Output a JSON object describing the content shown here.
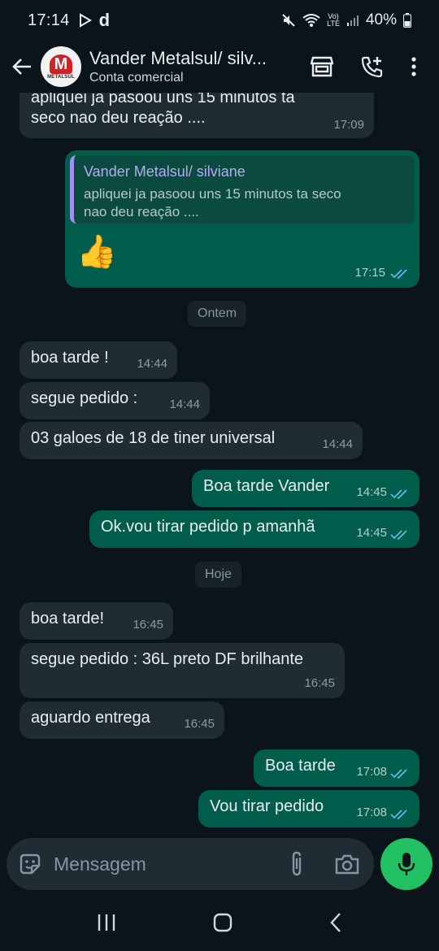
{
  "status": {
    "time": "17:14",
    "battery": "40%",
    "volte_top": "Vo)",
    "volte_bottom": "LTE"
  },
  "header": {
    "name": "Vander Metalsul/ silv...",
    "subtitle": "Conta comercial",
    "avatar_text": "METALSUL"
  },
  "messages": [
    {
      "text1": "apliquei ja pasoou uns 15 minutos ta",
      "text2": "seco nao deu reação ....",
      "time": "17:09"
    },
    {
      "quote_name": "Vander Metalsul/ silviane",
      "quote_text1": "apliquei ja pasoou uns 15 minutos ta seco",
      "quote_text2": "nao deu reação ....",
      "emoji": "👍",
      "time": "17:15"
    },
    {
      "date": "Ontem"
    },
    {
      "text": "boa tarde !",
      "time": "14:44"
    },
    {
      "text": "segue pedido :",
      "time": "14:44"
    },
    {
      "text": "03 galoes de 18 de tiner universal",
      "time": "14:44"
    },
    {
      "text": "Boa tarde Vander",
      "time": "14:45"
    },
    {
      "text": "Ok.vou tirar pedido  p amanhã",
      "time": "14:45"
    },
    {
      "date": "Hoje"
    },
    {
      "text": "boa tarde!",
      "time": "16:45"
    },
    {
      "text": "segue pedido : 36L preto DF brilhante",
      "time": "16:45"
    },
    {
      "text": "aguardo entrega",
      "time": "16:45"
    },
    {
      "text": "Boa tarde",
      "time": "17:08"
    },
    {
      "text": "Vou tirar  pedido",
      "time": "17:08"
    }
  ],
  "input": {
    "placeholder": "Mensagem"
  },
  "colors": {
    "incoming": "#202c33",
    "outgoing": "#005c4b",
    "mic": "#21c063",
    "read_ticks": "#53bdeb"
  }
}
